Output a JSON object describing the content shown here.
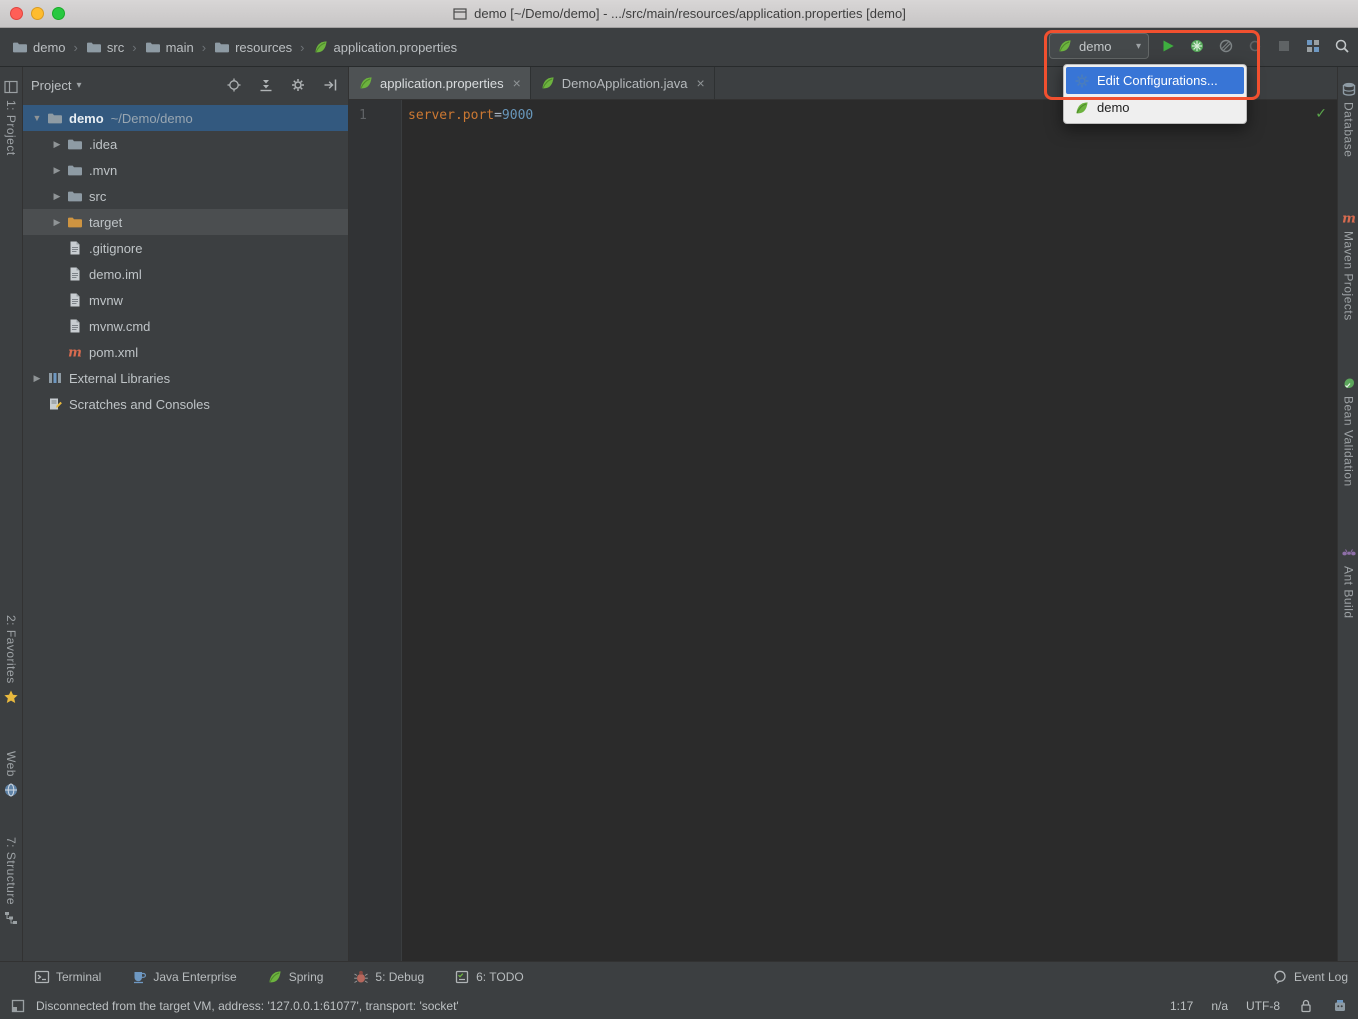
{
  "window": {
    "title": "demo [~/Demo/demo] - .../src/main/resources/application.properties [demo]",
    "icon": "window",
    "controls": [
      "close",
      "minimize",
      "zoom"
    ]
  },
  "navbar": {
    "breadcrumbs": [
      {
        "label": "demo",
        "icon": "folder"
      },
      {
        "label": "src",
        "icon": "folder"
      },
      {
        "label": "main",
        "icon": "folder"
      },
      {
        "label": "resources",
        "icon": "folder"
      },
      {
        "label": "application.properties",
        "icon": "leaf"
      }
    ]
  },
  "toolbar": {
    "run_config": "demo",
    "combo_icon": "leaf",
    "buttons": [
      {
        "name": "run",
        "icon": "play",
        "enabled": true
      },
      {
        "name": "run-with-coverage",
        "icon": "coverage",
        "enabled": true
      },
      {
        "name": "profiler",
        "icon": "hatched",
        "enabled": true
      },
      {
        "name": "rerun",
        "icon": "restart",
        "enabled": false
      },
      {
        "name": "stop",
        "icon": "stop",
        "enabled": false
      },
      {
        "name": "project-structure",
        "icon": "structure",
        "enabled": true
      },
      {
        "name": "search-everywhere",
        "icon": "search",
        "enabled": true
      }
    ]
  },
  "run_dropdown": {
    "items": [
      {
        "label": "Edit Configurations...",
        "icon": "gear-blue",
        "selected": true
      },
      {
        "label": "demo",
        "icon": "leaf",
        "selected": false
      }
    ]
  },
  "project": {
    "header": "Project",
    "header_icons": [
      {
        "name": "locate-file",
        "icon": "crosshair"
      },
      {
        "name": "collapse-all",
        "icon": "collapse"
      },
      {
        "name": "settings",
        "icon": "gear-gray"
      },
      {
        "name": "hide-panel",
        "icon": "hide"
      }
    ],
    "tree": [
      {
        "label": "demo",
        "suffix": "~/Demo/demo",
        "depth": 0,
        "arrow": "expanded",
        "icon": "folder",
        "state": "selected",
        "bold": true
      },
      {
        "label": ".idea",
        "depth": 1,
        "arrow": "collapsed",
        "icon": "folder"
      },
      {
        "label": ".mvn",
        "depth": 1,
        "arrow": "collapsed",
        "icon": "folder"
      },
      {
        "label": "src",
        "depth": 1,
        "arrow": "collapsed",
        "icon": "folder"
      },
      {
        "label": "target",
        "depth": 1,
        "arrow": "collapsed",
        "icon": "folder-excluded",
        "state": "hover"
      },
      {
        "label": ".gitignore",
        "depth": 1,
        "icon": "file"
      },
      {
        "label": "demo.iml",
        "depth": 1,
        "icon": "file"
      },
      {
        "label": "mvnw",
        "depth": 1,
        "icon": "file"
      },
      {
        "label": "mvnw.cmd",
        "depth": 1,
        "icon": "file"
      },
      {
        "label": "pom.xml",
        "depth": 1,
        "icon": "maven"
      },
      {
        "label": "External Libraries",
        "depth": 0,
        "arrow": "collapsed",
        "icon": "libraries"
      },
      {
        "label": "Scratches and Consoles",
        "depth": 0,
        "icon": "scratches"
      }
    ]
  },
  "editor": {
    "tabs": [
      {
        "label": "application.properties",
        "icon": "leaf",
        "active": true
      },
      {
        "label": "DemoApplication.java",
        "icon": "leaf",
        "active": false
      }
    ],
    "line_number": "1",
    "code": {
      "key": "server.port",
      "eq": "=",
      "value": "9000"
    },
    "inspection_status": "ok"
  },
  "left_strip": [
    {
      "label": "1: Project",
      "icon": "project-tool"
    },
    {
      "label": "2: Favorites",
      "icon": "star"
    },
    {
      "label": "Web",
      "icon": "globe"
    },
    {
      "label": "7: Structure",
      "icon": "structure-tool"
    }
  ],
  "right_strip": [
    {
      "label": "Database",
      "icon": "database"
    },
    {
      "label": "Maven Projects",
      "icon": "maven"
    },
    {
      "label": "Bean Validation",
      "icon": "bean"
    },
    {
      "label": "Ant Build",
      "icon": "ant"
    }
  ],
  "bottom_bar": {
    "tools": [
      {
        "label": "Terminal",
        "icon": "terminal"
      },
      {
        "label": "Java Enterprise",
        "icon": "java-ee"
      },
      {
        "label": "Spring",
        "icon": "leaf"
      },
      {
        "label": "5: Debug",
        "icon": "bug"
      },
      {
        "label": "6: TODO",
        "icon": "todo"
      }
    ],
    "event_log": "Event Log",
    "event_log_icon": "event-log"
  },
  "status_bar": {
    "message": "Disconnected from the target VM, address: '127.0.0.1:61077', transport: 'socket'",
    "caret": "1:17",
    "line_sep": "n/a",
    "encoding": "UTF-8",
    "icons": [
      "toolwindow-switcher",
      "lock",
      "hector"
    ]
  },
  "colors": {
    "annotation": "#F1502F",
    "menu_selection": "#3875D6",
    "run_green": "#3EAE3F",
    "spring_green": "#6DB33F",
    "panel_bg": "#3C3F41",
    "editor_bg": "#2B2B2B",
    "tree_selection": "#33597F"
  }
}
